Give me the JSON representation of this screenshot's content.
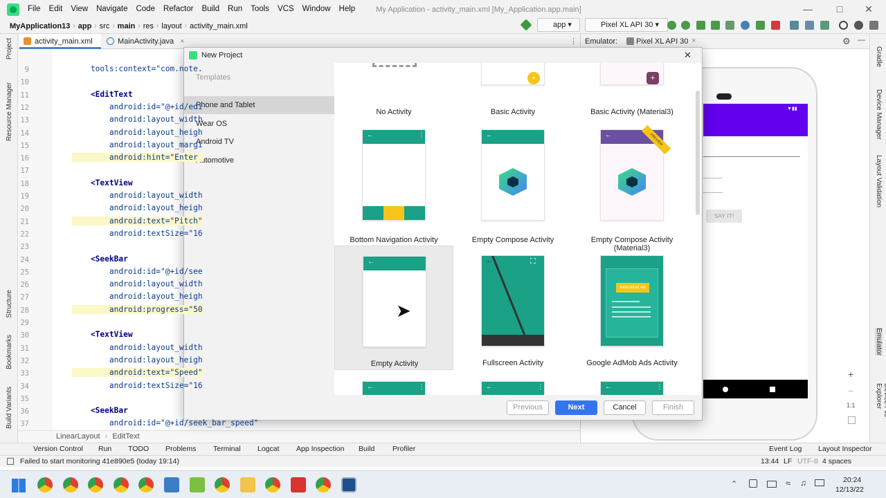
{
  "menubar": {
    "items": [
      "File",
      "Edit",
      "View",
      "Navigate",
      "Code",
      "Refactor",
      "Build",
      "Run",
      "Tools",
      "VCS",
      "Window",
      "Help"
    ],
    "title": "My Application - activity_main.xml [My_Application.app.main]"
  },
  "navbar": {
    "crumbs": [
      "MyApplication13",
      "app",
      "src",
      "main",
      "res",
      "layout",
      "activity_main.xml"
    ],
    "run_config": "app",
    "device": "Pixel XL API 30"
  },
  "editor_tabs": [
    {
      "label": "activity_main.xml"
    },
    {
      "label": "MainActivity.java"
    }
  ],
  "code": {
    "lines": [
      {
        "n": "9",
        "text": "    tools:context=\"com.note."
      },
      {
        "n": "10",
        "text": ""
      },
      {
        "n": "11",
        "text": "    <EditText"
      },
      {
        "n": "12",
        "text": "        android:id=\"@+id/edi"
      },
      {
        "n": "13",
        "text": "        android:layout_width"
      },
      {
        "n": "14",
        "text": "        android:layout_heigh"
      },
      {
        "n": "15",
        "text": "        android:layout_margi"
      },
      {
        "n": "16",
        "text": "        android:hint=\"Enter "
      },
      {
        "n": "17",
        "text": ""
      },
      {
        "n": "18",
        "text": "    <TextView"
      },
      {
        "n": "19",
        "text": "        android:layout_width"
      },
      {
        "n": "20",
        "text": "        android:layout_heigh"
      },
      {
        "n": "21",
        "text": "        android:text=\"Pitch\""
      },
      {
        "n": "22",
        "text": "        android:textSize=\"16"
      },
      {
        "n": "23",
        "text": ""
      },
      {
        "n": "24",
        "text": "    <SeekBar"
      },
      {
        "n": "25",
        "text": "        android:id=\"@+id/see"
      },
      {
        "n": "26",
        "text": "        android:layout_width"
      },
      {
        "n": "27",
        "text": "        android:layout_heigh"
      },
      {
        "n": "28",
        "text": "        android:progress=\"50"
      },
      {
        "n": "29",
        "text": ""
      },
      {
        "n": "30",
        "text": "    <TextView"
      },
      {
        "n": "31",
        "text": "        android:layout_width"
      },
      {
        "n": "32",
        "text": "        android:layout_heigh"
      },
      {
        "n": "33",
        "text": "        android:text=\"Speed\""
      },
      {
        "n": "34",
        "text": "        android:textSize=\"16"
      },
      {
        "n": "35",
        "text": ""
      },
      {
        "n": "36",
        "text": "    <SeekBar"
      },
      {
        "n": "37",
        "text": "        android:id=\"@+id/seek_bar_speed\""
      }
    ]
  },
  "code_breadcrumb": [
    "LinearLayout",
    "EditText"
  ],
  "left_tools": [
    "Project",
    "Resource Manager",
    "Structure",
    "Bookmarks",
    "Build Variants"
  ],
  "right_tools": [
    "Gradle",
    "Device Manager",
    "Layout Validation",
    "Emulator",
    "Device File Explorer"
  ],
  "emulator": {
    "label": "Emulator:",
    "device": "Pixel XL API 30",
    "say_button": "SAY IT!",
    "zoom_label": "1:1"
  },
  "dialog": {
    "title": "New Project",
    "categories_heading": "Templates",
    "categories": [
      "Phone and Tablet",
      "Wear OS",
      "Android TV",
      "Automotive"
    ],
    "templates": [
      "No Activity",
      "Basic Activity",
      "Basic Activity (Material3)",
      "Bottom Navigation Activity",
      "Empty Compose Activity",
      "Empty Compose Activity (Material3)",
      "Empty Activity",
      "Fullscreen Activity",
      "Google AdMob Ads Activity"
    ],
    "preview_badge": "PREVIEW",
    "ad_label": "Interstitial Ad",
    "buttons": {
      "previous": "Previous",
      "next": "Next",
      "cancel": "Cancel",
      "finish": "Finish"
    }
  },
  "bottom_tools": [
    "Version Control",
    "Run",
    "TODO",
    "Problems",
    "Terminal",
    "Logcat",
    "App Inspection",
    "Build",
    "Profiler",
    "Event Log",
    "Layout Inspector"
  ],
  "status": {
    "message": "Failed to start monitoring 41e890e5 (today 19:14)",
    "position": "13:44",
    "line_sep": "LF",
    "encoding": "UTF-8",
    "indent": "4 spaces"
  },
  "taskbar": {
    "time": "20:24",
    "date": "12/13/22"
  },
  "colors": {
    "accent": "#1aa186",
    "dialog_primary": "#3574f0",
    "emu_purple": "#6200ee",
    "material3_purple": "#6b4fa0",
    "yellow": "#f5c518"
  }
}
